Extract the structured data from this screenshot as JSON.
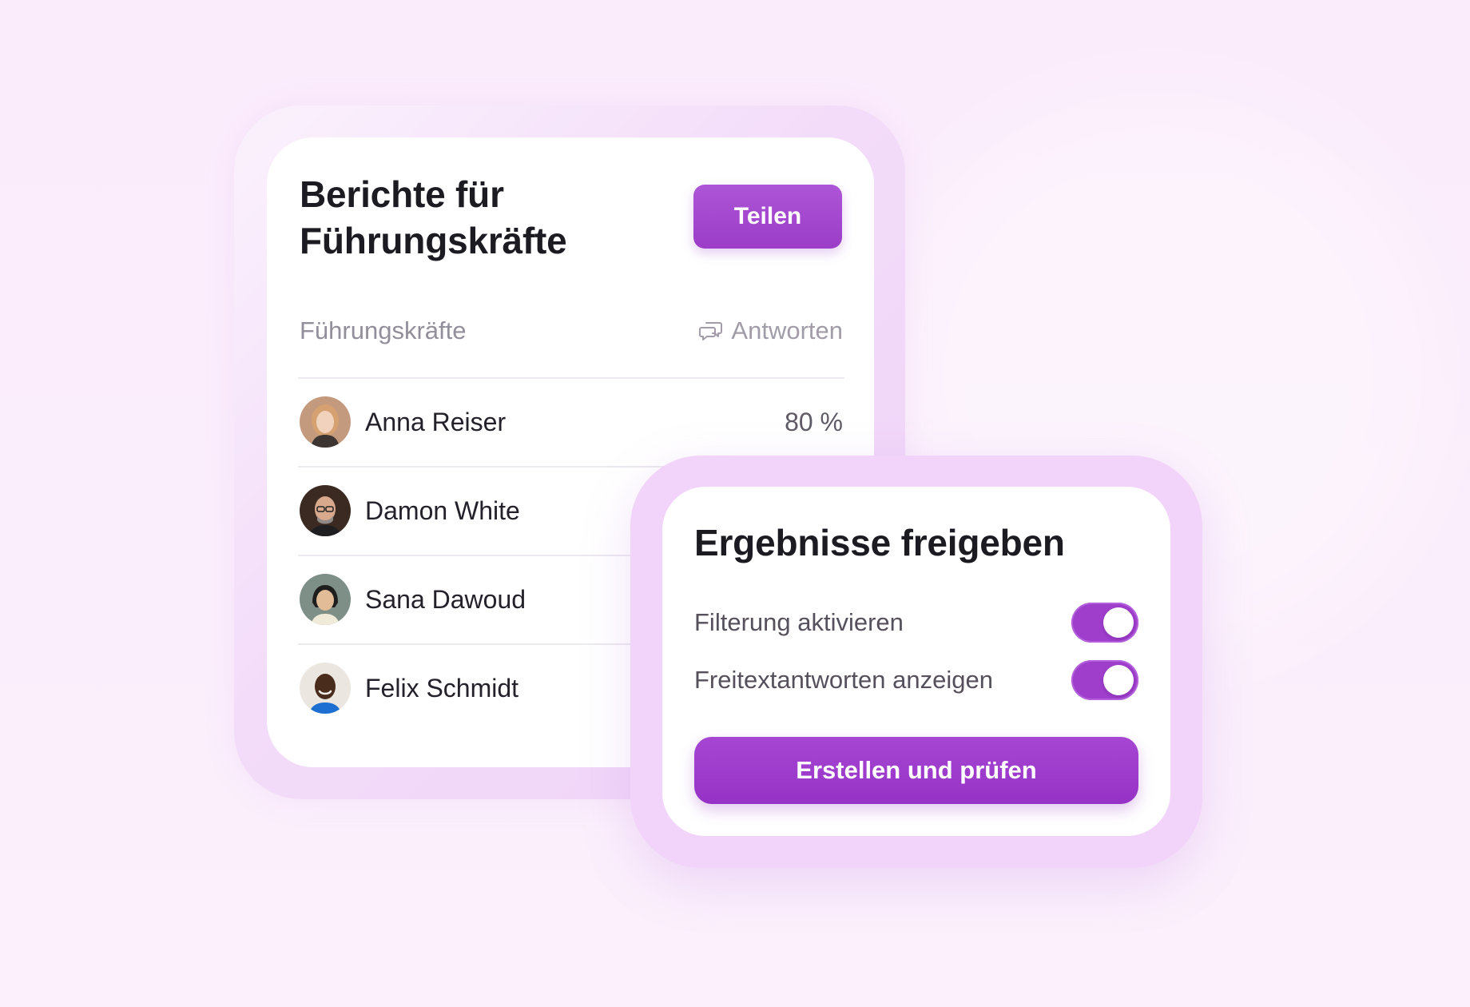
{
  "reports": {
    "title_line1": "Berichte für",
    "title_line2": "Führungskräfte",
    "share_label": "Teilen",
    "column_name": "Führungskräfte",
    "column_responses": "Antworten",
    "rows": [
      {
        "name": "Anna Reiser",
        "value": "80 %"
      },
      {
        "name": "Damon White",
        "value": ""
      },
      {
        "name": "Sana Dawoud",
        "value": ""
      },
      {
        "name": "Felix Schmidt",
        "value": ""
      }
    ]
  },
  "release": {
    "title": "Ergebnisse freigeben",
    "options": [
      {
        "label": "Filterung aktivieren",
        "enabled": true
      },
      {
        "label": "Freitextantworten anzeigen",
        "enabled": true
      }
    ],
    "create_label": "Erstellen und prüfen"
  },
  "colors": {
    "accent": "#9e3ecb",
    "background": "#fbeefc",
    "text_primary": "#1d1b22"
  },
  "icons": {
    "responses": "chat-bubbles-icon"
  }
}
